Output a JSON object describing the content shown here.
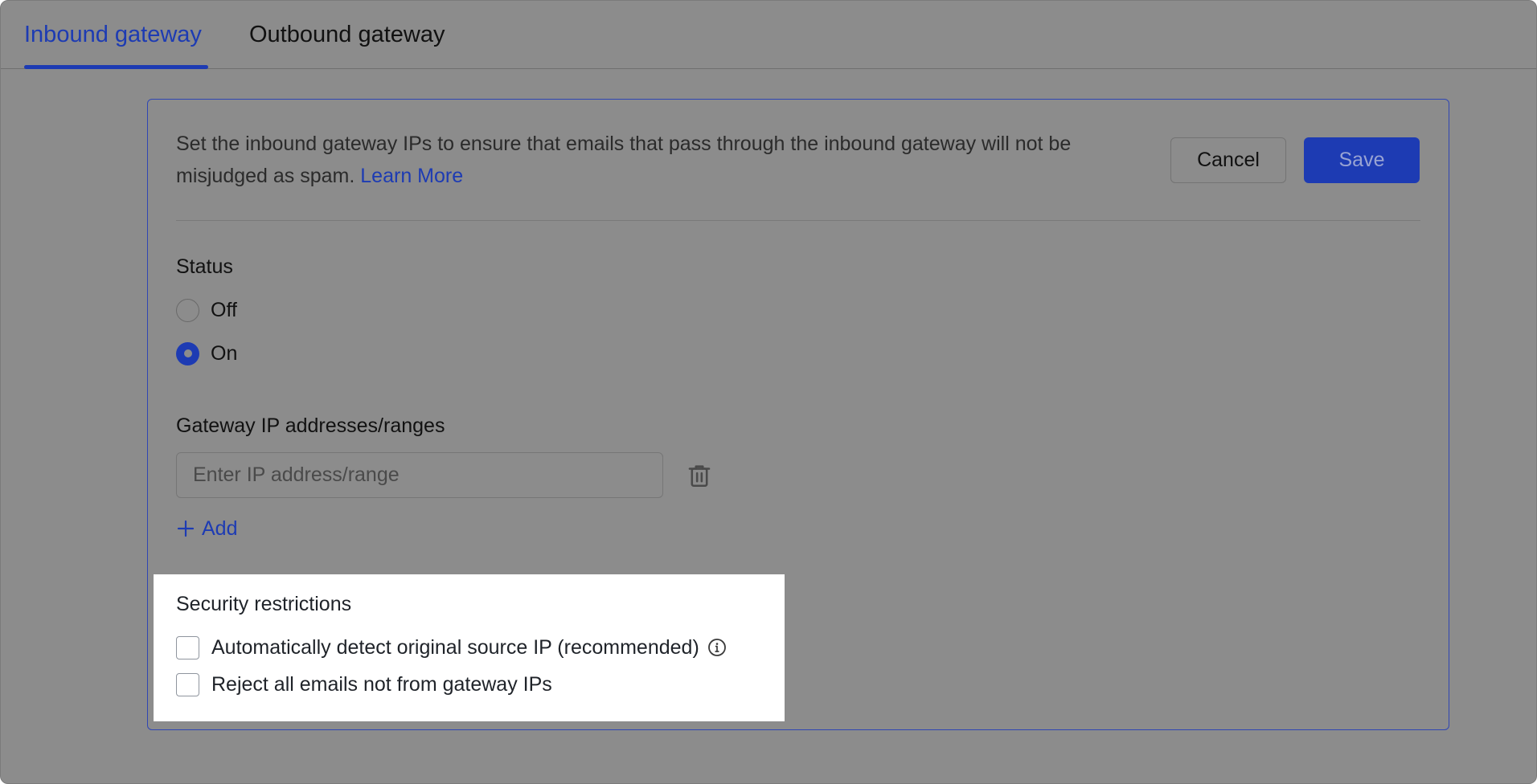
{
  "tabs": [
    {
      "label": "Inbound gateway",
      "active": true
    },
    {
      "label": "Outbound gateway",
      "active": false
    }
  ],
  "description": {
    "text": "Set the inbound gateway IPs to ensure that emails that pass through the inbound gateway will not be misjudged as spam.",
    "link": "Learn More"
  },
  "actions": {
    "cancel_label": "Cancel",
    "save_label": "Save"
  },
  "status": {
    "label": "Status",
    "options": [
      {
        "label": "Off",
        "selected": false
      },
      {
        "label": "On",
        "selected": true
      }
    ]
  },
  "gateway_ips": {
    "label": "Gateway IP addresses/ranges",
    "input_value": "",
    "placeholder": "Enter IP address/range",
    "add_label": "Add"
  },
  "security": {
    "title": "Security restrictions",
    "options": [
      {
        "label": "Automatically detect original source IP (recommended)",
        "checked": false
      },
      {
        "label": "Reject all emails not from gateway IPs",
        "checked": false
      }
    ]
  },
  "icons": {
    "info": "info-icon",
    "trash": "trash-icon",
    "plus": "plus-icon"
  },
  "colors": {
    "accent": "#1d3bb3",
    "overlay": "#8c8c8c",
    "highlight": "#ffffff"
  }
}
